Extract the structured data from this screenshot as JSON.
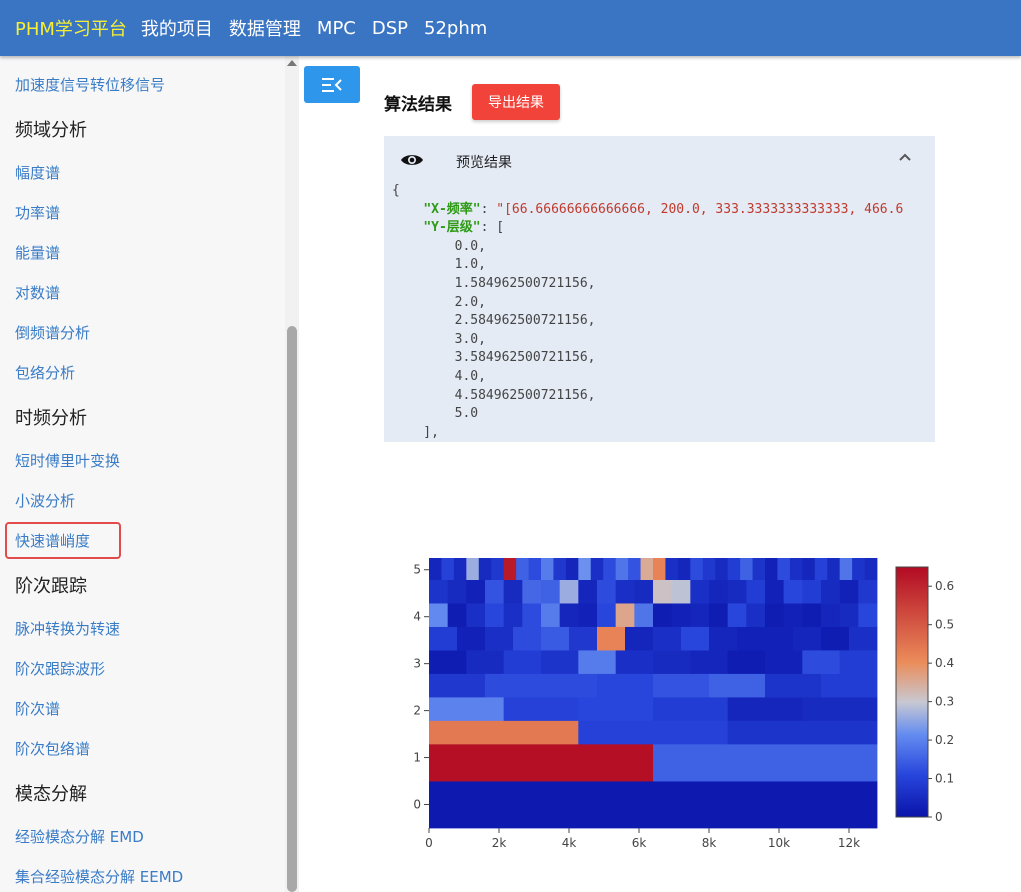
{
  "topbar": {
    "brand": "PHM学习平台",
    "nav": [
      "我的项目",
      "数据管理",
      "MPC",
      "DSP",
      "52phm"
    ]
  },
  "sidebar": {
    "entries": [
      {
        "type": "item",
        "label": "加速度信号转位移信号"
      },
      {
        "type": "heading",
        "label": "频域分析"
      },
      {
        "type": "item",
        "label": "幅度谱"
      },
      {
        "type": "item",
        "label": "功率谱"
      },
      {
        "type": "item",
        "label": "能量谱"
      },
      {
        "type": "item",
        "label": "对数谱"
      },
      {
        "type": "item",
        "label": "倒频谱分析"
      },
      {
        "type": "item",
        "label": "包络分析"
      },
      {
        "type": "heading",
        "label": "时频分析"
      },
      {
        "type": "item",
        "label": "短时傅里叶变换"
      },
      {
        "type": "item",
        "label": "小波分析"
      },
      {
        "type": "item",
        "label": "快速谱峭度",
        "selected": true
      },
      {
        "type": "heading",
        "label": "阶次跟踪"
      },
      {
        "type": "item",
        "label": "脉冲转换为转速"
      },
      {
        "type": "item",
        "label": "阶次跟踪波形"
      },
      {
        "type": "item",
        "label": "阶次谱"
      },
      {
        "type": "item",
        "label": "阶次包络谱"
      },
      {
        "type": "heading",
        "label": "模态分解"
      },
      {
        "type": "item",
        "label": "经验模态分解 EMD"
      },
      {
        "type": "item",
        "label": "集合经验模态分解 EEMD"
      }
    ]
  },
  "main": {
    "result_title": "算法结果",
    "export_label": "导出结果",
    "preview_title": "预览结果",
    "json_lines": [
      {
        "indent": 0,
        "text": "{"
      },
      {
        "indent": 1,
        "key": "X-频率",
        "value": "\"[66.66666666666666, 200.0, 333.3333333333333, 466.6"
      },
      {
        "indent": 1,
        "key": "Y-层级",
        "value": "["
      },
      {
        "indent": 2,
        "text": "0.0,"
      },
      {
        "indent": 2,
        "text": "1.0,"
      },
      {
        "indent": 2,
        "text": "1.584962500721156,"
      },
      {
        "indent": 2,
        "text": "2.0,"
      },
      {
        "indent": 2,
        "text": "2.584962500721156,"
      },
      {
        "indent": 2,
        "text": "3.0,"
      },
      {
        "indent": 2,
        "text": "3.584962500721156,"
      },
      {
        "indent": 2,
        "text": "4.0,"
      },
      {
        "indent": 2,
        "text": "4.584962500721156,"
      },
      {
        "indent": 2,
        "text": "5.0"
      },
      {
        "indent": 1,
        "text": "],"
      }
    ]
  },
  "colors": {
    "topbar": "#3a75c4",
    "brand": "#f6ef35",
    "link": "#3a7cc6",
    "export": "#f2433b",
    "toggle": "#2e97eb",
    "selected_border": "#e24b4b"
  },
  "icons": {
    "toggle": "sidebar-collapse-icon",
    "preview": "eye-icon",
    "collapse": "chevron-up-icon"
  },
  "chart_data": {
    "type": "heatmap",
    "x_range": [
      0,
      12800
    ],
    "y_range": [
      -0.5,
      5.25
    ],
    "x_ticks": [
      0,
      2000,
      4000,
      6000,
      8000,
      10000,
      12000
    ],
    "x_tick_labels": [
      "0",
      "2k",
      "4k",
      "6k",
      "8k",
      "10k",
      "12k"
    ],
    "y_ticks": [
      0,
      1,
      2,
      3,
      4,
      5
    ],
    "colorbar": {
      "min": 0,
      "max": 0.65,
      "ticks": [
        0,
        0.1,
        0.2,
        0.3,
        0.4,
        0.5,
        0.6
      ]
    },
    "rows": [
      {
        "y0": -0.5,
        "y1": 0.5,
        "values": [
          0.01
        ]
      },
      {
        "y0": 0.5,
        "y1": 1.29,
        "values": [
          0.64,
          0.15
        ]
      },
      {
        "y0": 1.29,
        "y1": 1.79,
        "values": [
          0.44,
          0.1,
          0.07
        ]
      },
      {
        "y0": 1.79,
        "y1": 2.29,
        "values": [
          0.2,
          0.1,
          0.11,
          0.09,
          0.04,
          0.05
        ]
      },
      {
        "y0": 2.29,
        "y1": 2.79,
        "values": [
          0.08,
          0.12,
          0.12,
          0.11,
          0.13,
          0.15,
          0.07,
          0.09
        ]
      },
      {
        "y0": 2.79,
        "y1": 3.29,
        "values": [
          0.02,
          0.05,
          0.09,
          0.07,
          0.19,
          0.06,
          0.05,
          0.04,
          0.02,
          0.03,
          0.12,
          0.09
        ]
      },
      {
        "y0": 3.29,
        "y1": 3.79,
        "values": [
          0.09,
          0.03,
          0.06,
          0.12,
          0.14,
          0.08,
          0.42,
          0.04,
          0.06,
          0.11,
          0.04,
          0.03,
          0.03,
          0.04,
          0.02,
          0.06
        ]
      },
      {
        "y0": 3.79,
        "y1": 4.29,
        "values": [
          0.21,
          0.02,
          0.06,
          0.11,
          0.06,
          0.12,
          0.19,
          0.04,
          0.03,
          0.11,
          0.36,
          0.18,
          0.02,
          0.03,
          0.04,
          0.02,
          0.11,
          0.06,
          0.02,
          0.03,
          0.02,
          0.04,
          0.05,
          0.11
        ]
      },
      {
        "y0": 4.29,
        "y1": 4.79,
        "values": [
          0.07,
          0.05,
          0.03,
          0.13,
          0.05,
          0.16,
          0.15,
          0.26,
          0.04,
          0.12,
          0.06,
          0.05,
          0.31,
          0.29,
          0.06,
          0.04,
          0.05,
          0.09,
          0.03,
          0.11,
          0.09,
          0.05,
          0.03,
          0.08
        ]
      },
      {
        "y0": 4.79,
        "y1": 5.25,
        "values": [
          0.04,
          0.1,
          0.05,
          0.26,
          0.05,
          0.08,
          0.62,
          0.15,
          0.12,
          0.19,
          0.08,
          0.04,
          0.22,
          0.06,
          0.12,
          0.18,
          0.13,
          0.35,
          0.42,
          0.06,
          0.04,
          0.12,
          0.08,
          0.05,
          0.09,
          0.15,
          0.07,
          0.03,
          0.12,
          0.06,
          0.04,
          0.1,
          0.05,
          0.18,
          0.07,
          0.05
        ]
      }
    ]
  }
}
